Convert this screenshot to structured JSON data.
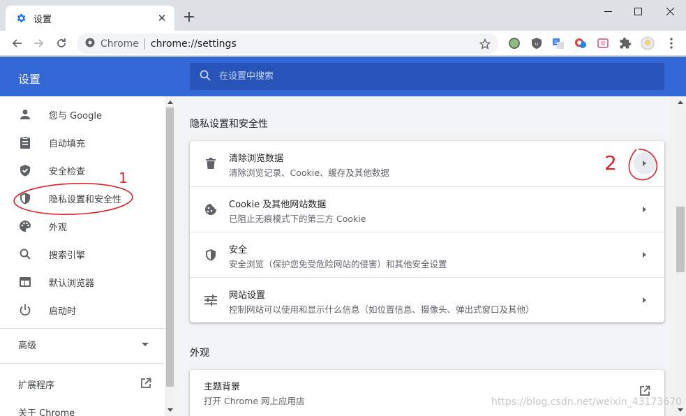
{
  "browser": {
    "tab_title": "设置",
    "omnibox_prefix": "Chrome",
    "url": "chrome://settings"
  },
  "header": {
    "title": "设置",
    "search_placeholder": "在设置中搜索"
  },
  "sidebar": {
    "items": [
      {
        "label": "您与 Google",
        "icon": "person-icon"
      },
      {
        "label": "自动填充",
        "icon": "clipboard-icon"
      },
      {
        "label": "安全检查",
        "icon": "shield-check-icon"
      },
      {
        "label": "隐私设置和安全性",
        "icon": "shield-half-icon"
      },
      {
        "label": "外观",
        "icon": "palette-icon"
      },
      {
        "label": "搜索引擎",
        "icon": "search-icon"
      },
      {
        "label": "默认浏览器",
        "icon": "browser-icon"
      },
      {
        "label": "启动时",
        "icon": "power-icon"
      }
    ],
    "advanced_label": "高级",
    "extensions_label": "扩展程序",
    "about_label": "关于 Chrome"
  },
  "main": {
    "privacy_section_title": "隐私设置和安全性",
    "privacy_rows": [
      {
        "title": "清除浏览数据",
        "subtitle": "清除浏览记录、Cookie、缓存及其他数据",
        "icon": "trash-icon"
      },
      {
        "title": "Cookie 及其他网站数据",
        "subtitle": "已阻止无痕模式下的第三方 Cookie",
        "icon": "cookie-icon"
      },
      {
        "title": "安全",
        "subtitle": "安全浏览（保护您免受危险网站的侵害）和其他安全设置",
        "icon": "security-shield-icon"
      },
      {
        "title": "网站设置",
        "subtitle": "控制网站可以使用和显示什么信息（如位置信息、摄像头、弹出式窗口及其他）",
        "icon": "tune-icon"
      }
    ],
    "appearance_section_title": "外观",
    "appearance_rows": [
      {
        "title": "主题背景",
        "subtitle": "打开 Chrome 网上应用店"
      }
    ]
  },
  "annotations": {
    "mark_1": "1",
    "mark_2": "2"
  },
  "watermark": "https://blog.csdn.net/weixin_43173670",
  "colors": {
    "header_blue": "#3367d6",
    "annotation_red": "#e0202a"
  }
}
